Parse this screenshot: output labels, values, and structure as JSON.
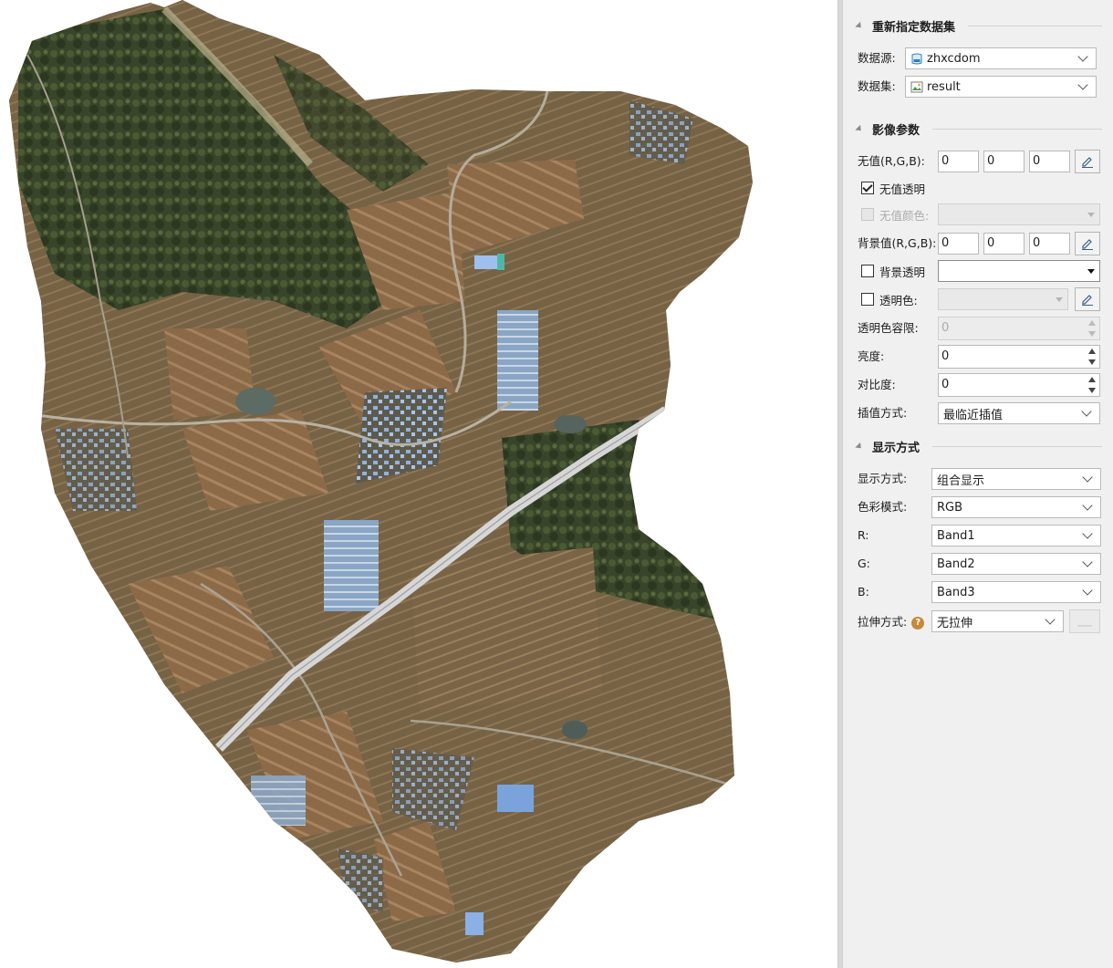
{
  "panel": {
    "sections": {
      "dataset": "重新指定数据集",
      "image_params": "影像参数",
      "display": "显示方式"
    },
    "dataset": {
      "source_label": "数据源:",
      "source_value": "zhxcdom",
      "dataset_label": "数据集:",
      "dataset_value": "result"
    },
    "image": {
      "nodata_label": "无值(R,G,B):",
      "nodata_r": "0",
      "nodata_g": "0",
      "nodata_b": "0",
      "nodata_transparent_label": "无值透明",
      "nodata_transparent_checked": true,
      "nodata_color_label": "无值颜色:",
      "background_label": "背景值(R,G,B):",
      "bg_r": "0",
      "bg_g": "0",
      "bg_b": "0",
      "background_transparent_label": "背景透明",
      "background_transparent_checked": false,
      "transparent_color_label": "透明色:",
      "transparent_color_checked": false,
      "tolerance_label": "透明色容限:",
      "tolerance_value": "0",
      "brightness_label": "亮度:",
      "brightness_value": "0",
      "contrast_label": "对比度:",
      "contrast_value": "0",
      "interp_label": "插值方式:",
      "interp_value": "最临近插值"
    },
    "display": {
      "mode_label": "显示方式:",
      "mode_value": "组合显示",
      "color_label": "色彩模式:",
      "color_value": "RGB",
      "r_label": "R:",
      "r_value": "Band1",
      "g_label": "G:",
      "g_value": "Band2",
      "b_label": "B:",
      "b_value": "Band3",
      "stretch_label": "拉伸方式:",
      "stretch_help": "?",
      "stretch_value": "无拉伸"
    }
  },
  "colors": {
    "panel_bg": "#f0f0f0",
    "map_bg": "#ffffff",
    "help_icon": "#c58a3a"
  }
}
